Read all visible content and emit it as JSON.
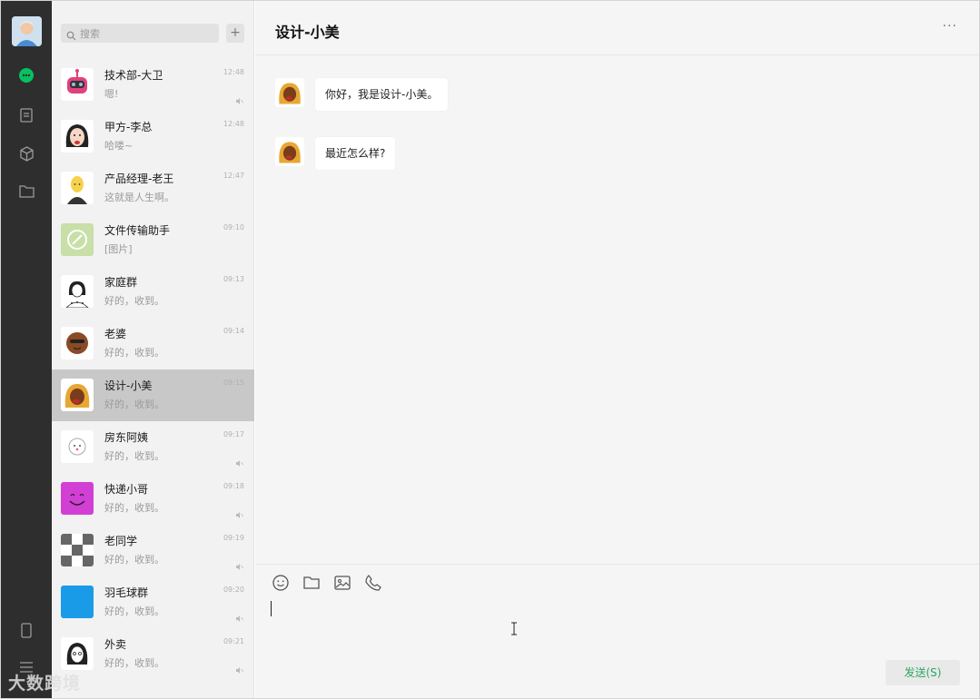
{
  "search": {
    "placeholder": "搜索"
  },
  "list_add": "+",
  "conversations": [
    {
      "name": "技术部-大卫",
      "time": "12:48",
      "msg": "嗯!",
      "muted": true
    },
    {
      "name": "甲方-李总",
      "time": "12:48",
      "msg": "哈喽~",
      "muted": false
    },
    {
      "name": "产品经理-老王",
      "time": "12:47",
      "msg": "这就是人生啊。",
      "muted": false
    },
    {
      "name": "文件传输助手",
      "time": "09:10",
      "msg": "[图片]",
      "muted": false
    },
    {
      "name": "家庭群",
      "time": "09:13",
      "msg": "好的，收到。",
      "muted": false
    },
    {
      "name": "老婆",
      "time": "09:14",
      "msg": "好的，收到。",
      "muted": false
    },
    {
      "name": "设计-小美",
      "time": "09:15",
      "msg": "好的，收到。",
      "muted": false
    },
    {
      "name": "房东阿姨",
      "time": "09:17",
      "msg": "好的，收到。",
      "muted": true
    },
    {
      "name": "快递小哥",
      "time": "09:18",
      "msg": "好的，收到。",
      "muted": true
    },
    {
      "name": "老同学",
      "time": "09:19",
      "msg": "好的，收到。",
      "muted": true
    },
    {
      "name": "羽毛球群",
      "time": "09:20",
      "msg": "好的，收到。",
      "muted": true
    },
    {
      "name": "外卖",
      "time": "09:21",
      "msg": "好的，收到。",
      "muted": true
    }
  ],
  "chat": {
    "title": "设计-小美",
    "more": "···",
    "messages": [
      {
        "text": "你好，我是设计-小美。"
      },
      {
        "text": "最近怎么样?"
      }
    ],
    "send_label": "发送(S)"
  },
  "watermark": "大数跨境",
  "colors": {
    "rail": "#2e2e2e",
    "active_nav": "#07c160",
    "send_text": "#2ca663"
  },
  "icons": {
    "rail": [
      "chat-icon",
      "contacts-icon",
      "box-icon",
      "folder-icon",
      "phone-icon",
      "menu-icon"
    ],
    "toolbar": [
      "emoji-icon",
      "folder-icon",
      "image-icon",
      "phone-icon"
    ]
  }
}
